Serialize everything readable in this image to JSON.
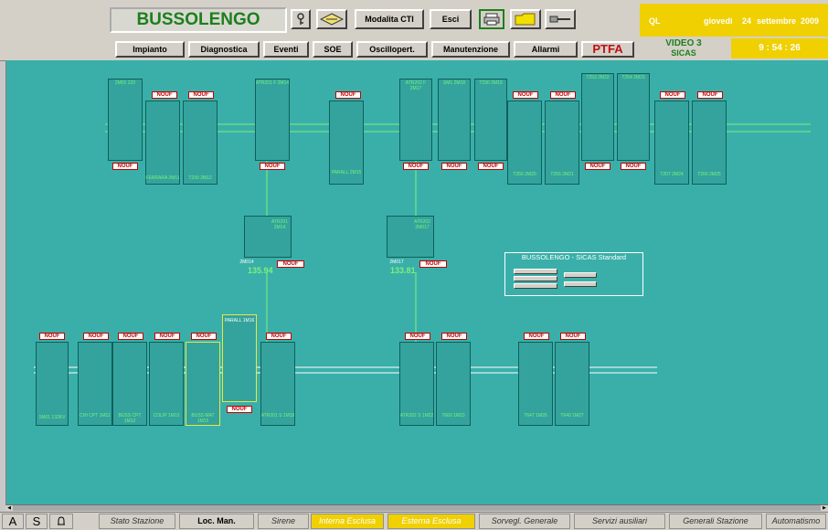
{
  "header": {
    "station": "BUSSOLENGO",
    "modalita_label": "Modalita CTI",
    "esci_label": "Esci",
    "nav": [
      "Impianto",
      "Diagnostica",
      "Eventi",
      "SOE",
      "Oscillopert.",
      "Manutenzione",
      "Allarmi"
    ],
    "ptfa_label": "PTFA",
    "icons": [
      "key-icon",
      "network-icon",
      "printer-icon",
      "folder-icon",
      "cable-icon"
    ]
  },
  "datebar": {
    "ql": "QL",
    "weekday": "giovedi",
    "day": "24",
    "month": "settembre",
    "year": "2009"
  },
  "video": {
    "title": "VIDEO 3",
    "sub": "SICAS"
  },
  "clock": {
    "time": "9 : 54 : 26"
  },
  "synoptic": {
    "info_title": "BUSSOLENGO - SICAS Standard",
    "transformers": [
      {
        "name": "ATR201 2M14",
        "code": "2M014",
        "tag": "NOUF",
        "measure": "135.94"
      },
      {
        "name": "ATR202 2M017",
        "code": "2M017",
        "tag": "NOUF",
        "measure": "133.81"
      }
    ],
    "upper_bays": [
      {
        "id": "u1",
        "name": "2M01 220",
        "tag": "NOUF"
      },
      {
        "id": "u2",
        "name": "FERRARA 2M11",
        "tag": "NOUF"
      },
      {
        "id": "u3",
        "name": "T230 2M12",
        "tag": "NOUF"
      },
      {
        "id": "u4",
        "name": "ATR201 F 2M14",
        "tag": "NOUF"
      },
      {
        "id": "u5",
        "name": "PARALL 2M15",
        "tag": "NOUF"
      },
      {
        "id": "u6",
        "name": "ATR202 F 2M17",
        "tag": "NOUF"
      },
      {
        "id": "u7",
        "name": "SM1 2M18",
        "tag": "NOUF"
      },
      {
        "id": "u8",
        "name": "T230 2M19",
        "tag": "NOUF"
      },
      {
        "id": "u9",
        "name": "T256 2M20",
        "tag": "NOUF"
      },
      {
        "id": "u10",
        "name": "T255 2M21",
        "tag": "NOUF"
      },
      {
        "id": "u11",
        "name": "T253 2M22",
        "tag": "NOUF"
      },
      {
        "id": "u12",
        "name": "T254 2M23",
        "tag": "NOUF"
      },
      {
        "id": "u13",
        "name": "T207 2M24",
        "tag": "NOUF"
      },
      {
        "id": "u14",
        "name": "T206 2M25",
        "tag": "NOUF"
      }
    ],
    "lower_bays": [
      {
        "id": "l1",
        "name": "1M01 132KV",
        "tag": "NOUF"
      },
      {
        "id": "l2",
        "name": "CHI CPT 1M11",
        "tag": "NOUF"
      },
      {
        "id": "l3",
        "name": "BUSS CPT 1M12",
        "tag": "NOUF"
      },
      {
        "id": "l4",
        "name": "COLIP 1M13",
        "tag": "NOUF"
      },
      {
        "id": "l5",
        "name": "BUSS MAT 1M15",
        "tag": "NOUF"
      },
      {
        "id": "l6",
        "name": "PARALL 1M16",
        "tag": "NOUF"
      },
      {
        "id": "l7",
        "name": "ATR201 S 1M18",
        "tag": "NOUF"
      },
      {
        "id": "l8",
        "name": "ATR202 S 1M22",
        "tag": "NOUF"
      },
      {
        "id": "l9",
        "name": "T660 1M23",
        "tag": "NOUF"
      },
      {
        "id": "l10",
        "name": "T647 1M26",
        "tag": "NOUF"
      },
      {
        "id": "l11",
        "name": "T640 1M27",
        "tag": "NOUF"
      }
    ]
  },
  "statusbar": {
    "letters": [
      "A",
      "S"
    ],
    "stato": "Stato Stazione",
    "loc": "Loc. Man.",
    "sirene": "Sirene",
    "interna": "Interna Esclusa",
    "esterna": "Esterna Esclusa",
    "sorveg": "Sorvegl. Generale",
    "servizi": "Servizi ausiliari",
    "generali": "Generali Stazione",
    "automatismo": "Automatismo"
  },
  "colors": {
    "background": "#3aafa9",
    "busbar": "#7cf07c",
    "alarm": "#f0d000"
  }
}
